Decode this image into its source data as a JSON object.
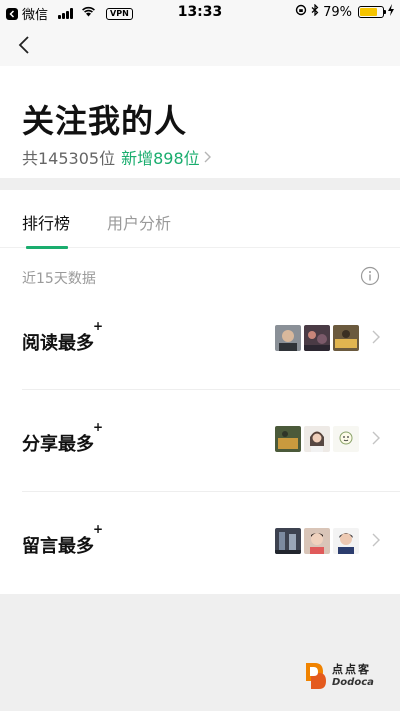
{
  "status_bar": {
    "carrier": "微信",
    "vpn": "VPN",
    "time": "13:33",
    "battery": "79%",
    "battery_level": 0.79
  },
  "header": {
    "title": "关注我的人",
    "total_followers": "共145305位",
    "new_followers": "新增898位"
  },
  "tabs": [
    {
      "label": "排行榜",
      "active": true
    },
    {
      "label": "用户分析",
      "active": false
    }
  ],
  "data_range": "近15天数据",
  "rankings": [
    {
      "label": "阅读最多",
      "plus": "+"
    },
    {
      "label": "分享最多",
      "plus": "+"
    },
    {
      "label": "留言最多",
      "plus": "+"
    }
  ],
  "watermark": {
    "text_cn": "点点客",
    "text_en": "Dodoca"
  },
  "colors": {
    "accent": "#1aad6e",
    "battery": "#f5c400",
    "watermark_orange": "#f08300"
  },
  "icons": [
    "back-chevron-icon",
    "info-icon",
    "chevron-right-icon",
    "signal-icon",
    "wifi-icon",
    "bluetooth-icon",
    "lock-rotation-icon",
    "charging-icon"
  ]
}
